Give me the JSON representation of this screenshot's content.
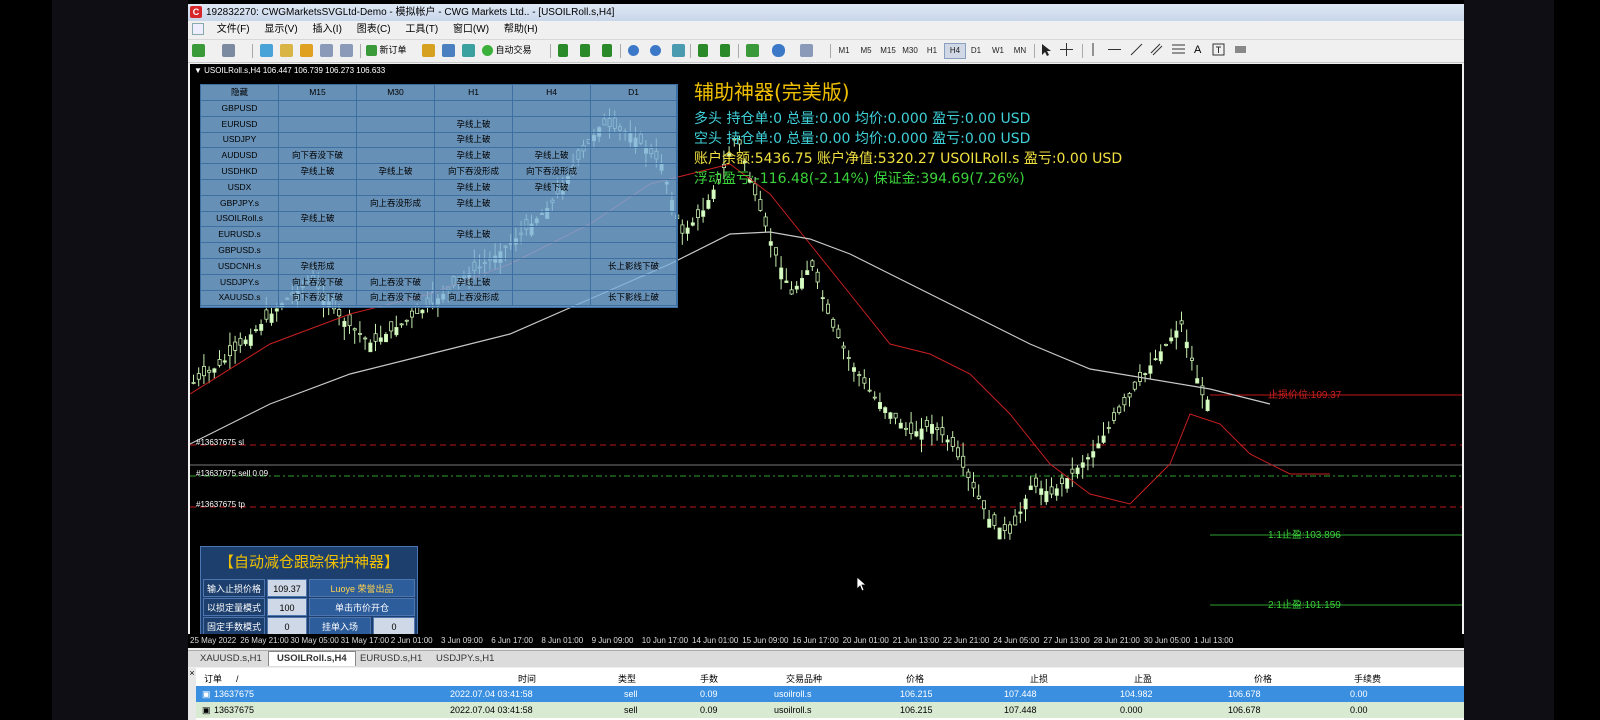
{
  "window": {
    "title": "192832270: CWGMarketsSVGLtd-Demo - 模拟帐户 - CWG Markets Ltd.. - [USOILRoll.s,H4]",
    "app_icon_letter": "C"
  },
  "menu": [
    "文件(F)",
    "显示(V)",
    "插入(I)",
    "图表(C)",
    "工具(T)",
    "窗口(W)",
    "帮助(H)"
  ],
  "toolbar": {
    "new_order": "新订单",
    "auto_trade": "自动交易",
    "timeframes": [
      "M1",
      "M5",
      "M15",
      "M30",
      "H1",
      "H4",
      "D1",
      "W1",
      "MN"
    ],
    "active_timeframe": "H4",
    "text_tool": "A"
  },
  "chart": {
    "info": "USOILRoll.s,H4  106.447 106.739 106.273 106.633",
    "stoploss_label": "止损价位:109.37",
    "tp1_label": "1:1止盈:103.896",
    "tp2_label": "2:1止盈:101.159",
    "line_sl": "#13637675 sl",
    "line_order": "#13637675 sell 0.09",
    "line_tp": "#13637675 tp",
    "x_labels": [
      "25 May 2022",
      "26 May 21:00",
      "30 May 05:00",
      "31 May 17:00",
      "2 Jun 01:00",
      "3 Jun 09:00",
      "6 Jun 17:00",
      "8 Jun 01:00",
      "9 Jun 09:00",
      "10 Jun 17:00",
      "14 Jun 01:00",
      "15 Jun 09:00",
      "16 Jun 17:00",
      "20 Jun 01:00",
      "21 Jun 13:00",
      "22 Jun 21:00",
      "24 Jun 05:00",
      "27 Jun 13:00",
      "28 Jun 21:00",
      "30 Jun 05:00",
      "1 Jul 13:00"
    ]
  },
  "scanner": {
    "headers": [
      "隐藏",
      "M15",
      "M30",
      "H1",
      "H4",
      "D1"
    ],
    "rows": [
      [
        "GBPUSD",
        "",
        "",
        "",
        "",
        ""
      ],
      [
        "EURUSD",
        "",
        "",
        "孕线上破",
        "",
        ""
      ],
      [
        "USDJPY",
        "",
        "",
        "孕线上破",
        "",
        ""
      ],
      [
        "AUDUSD",
        "向下吞没下破",
        "",
        "孕线上破",
        "孕线上破",
        ""
      ],
      [
        "USDHKD",
        "孕线上破",
        "孕线上破",
        "向下吞没形成",
        "向下吞没形成",
        ""
      ],
      [
        "USDX",
        "",
        "",
        "孕线上破",
        "孕线下破",
        ""
      ],
      [
        "GBPJPY.s",
        "",
        "向上吞没形成",
        "孕线上破",
        "",
        ""
      ],
      [
        "USOILRoll.s",
        "孕线上破",
        "",
        "",
        "",
        ""
      ],
      [
        "EURUSD.s",
        "",
        "",
        "孕线上破",
        "",
        ""
      ],
      [
        "GBPUSD.s",
        "",
        "",
        "",
        "",
        ""
      ],
      [
        "USDCNH.s",
        "孕线形成",
        "",
        "",
        "",
        "长上影线下破"
      ],
      [
        "USDJPY.s",
        "向上吞没下破",
        "向上吞没下破",
        "孕线上破",
        "",
        ""
      ],
      [
        "XAUUSD.s",
        "向下吞没下破",
        "向上吞没下破",
        "向上吞没形成",
        "",
        "长下影线上破"
      ]
    ]
  },
  "info_panel": {
    "title": "辅助神器(完美版)",
    "long_line": "多头  持仓单:0  总量:0.00  均价:0.000  盈亏:0.00 USD",
    "short_line": "空头  持仓单:0  总量:0.00  均价:0.000  盈亏:0.00 USD",
    "account_line": "账户余额:5436.75  账户净值:5320.27 USOILRoll.s  盈亏:0.00 USD",
    "float_line": "浮动盈亏:-116.48(-2.14%)  保证金:394.69(7.26%)",
    "colors": {
      "title": "#f0c000",
      "long": "#3fd0d8",
      "short": "#3fd0d8",
      "account": "#f0e040",
      "float": "#3ad23a"
    }
  },
  "bottom_panel": {
    "title": "【自动减仓跟踪保护神器】",
    "row1_label": "输入止损价格",
    "row1_value": "109.37",
    "row1_button": "Luoye 荣誉出品",
    "row2_label": "以损定量模式",
    "row2_value": "100",
    "row2_button": "单击市价开仓",
    "row3_label": "固定手数模式",
    "row3_value": "0",
    "row3_button": "挂单入场",
    "row3_value2": "0"
  },
  "tabs": [
    "XAUUSD.s,H1",
    "USOILRoll.s,H4",
    "EURUSD.s,H1",
    "USDJPY.s,H1"
  ],
  "active_tab": "USOILRoll.s,H4",
  "orders": {
    "columns": [
      "订单",
      "/",
      "时间",
      "类型",
      "手数",
      "交易品种",
      "价格",
      "止损",
      "止盈",
      "价格",
      "手续费"
    ],
    "rows": [
      {
        "order": "13637675",
        "time": "2022.07.04 03:41:58",
        "type": "sell",
        "lots": "0.09",
        "symbol": "usoilroll.s",
        "price": "106.215",
        "sl": "107.448",
        "tp": "104.982",
        "cur_price": "106.678",
        "commission": "0.00"
      },
      {
        "order": "13637675",
        "time": "2022.07.04 03:41:58",
        "type": "sell",
        "lots": "0.09",
        "symbol": "usoilroll.s",
        "price": "106.215",
        "sl": "107.448",
        "tp": "0.000",
        "cur_price": "106.678",
        "commission": "0.00"
      }
    ],
    "close_glyph": "×"
  }
}
